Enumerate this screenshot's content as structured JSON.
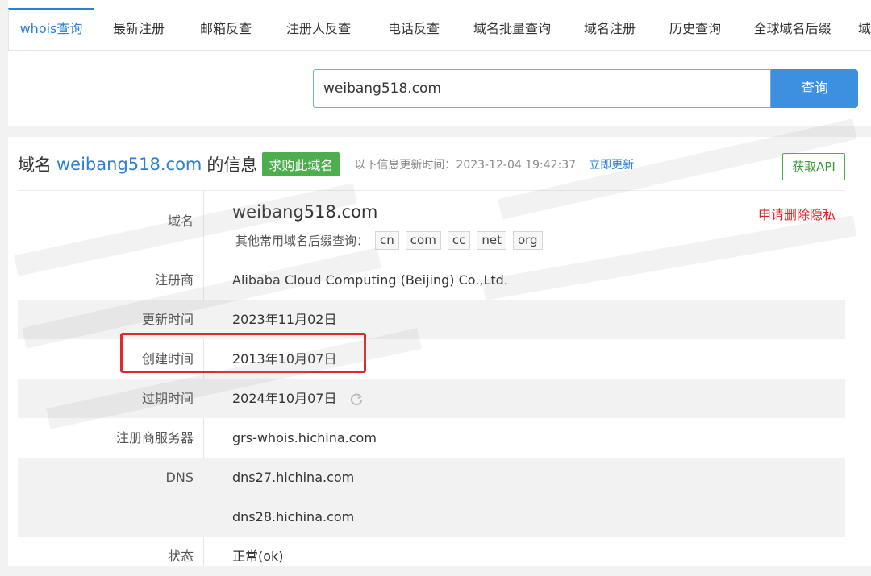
{
  "tabs": [
    {
      "label": "whois查询",
      "active": true
    },
    {
      "label": "最新注册"
    },
    {
      "label": "邮箱反查"
    },
    {
      "label": "注册人反查"
    },
    {
      "label": "电话反查"
    },
    {
      "label": "域名批量查询"
    },
    {
      "label": "域名注册"
    },
    {
      "label": "历史查询"
    },
    {
      "label": "全球域名后缀"
    },
    {
      "label": "域"
    }
  ],
  "search": {
    "value": "weibang518.com",
    "button_label": "查询"
  },
  "info": {
    "head_prefix": "域名",
    "head_domain": "weibang518.com",
    "head_suffix": "的信息",
    "buy_label": "求购此域名",
    "update_text": "以下信息更新时间：2023-12-04 19:42:37",
    "update_link": "立即更新",
    "api_label": "获取API"
  },
  "rows": {
    "domain": {
      "label": "域名",
      "value": "weibang518.com",
      "suffix_prompt": "其他常用域名后缀查询：",
      "suffixes": [
        "cn",
        "com",
        "cc",
        "net",
        "org"
      ],
      "privacy_link": "申请删除隐私"
    },
    "registrar": {
      "label": "注册商",
      "value": "Alibaba Cloud Computing (Beijing) Co.,Ltd."
    },
    "updated": {
      "label": "更新时间",
      "value": "2023年11月02日"
    },
    "created": {
      "label": "创建时间",
      "value": "2013年10月07日"
    },
    "expires": {
      "label": "过期时间",
      "value": "2024年10月07日"
    },
    "whois_server": {
      "label": "注册商服务器",
      "value": "grs-whois.hichina.com"
    },
    "dns": {
      "label": "DNS",
      "values": [
        "dns27.hichina.com",
        "dns28.hichina.com"
      ]
    },
    "status": {
      "label": "状态",
      "value": "正常(ok)"
    }
  },
  "colors": {
    "accent": "#2d7ed8",
    "buy_green": "#4cae4c",
    "highlight_red": "#e0282e",
    "privacy_red": "#e02020"
  }
}
